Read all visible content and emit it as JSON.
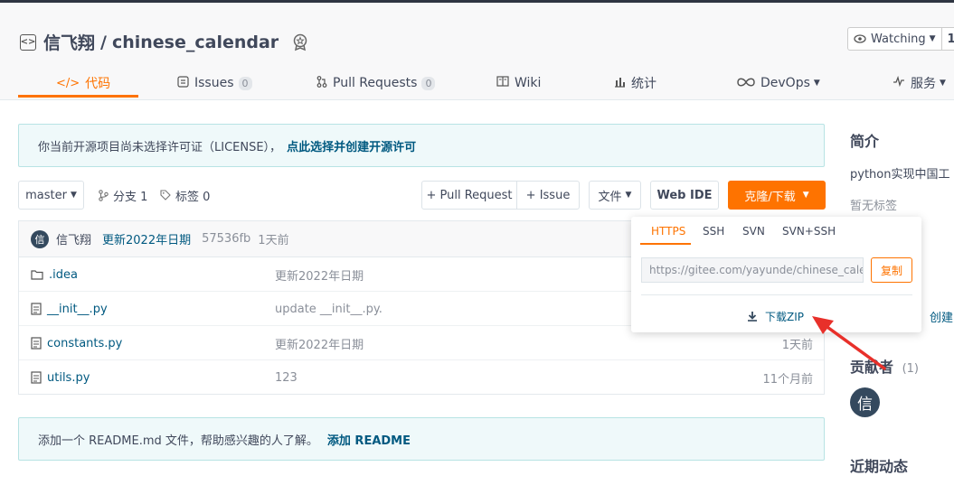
{
  "repo": {
    "owner": "信飞翔",
    "separator": "/",
    "name": "chinese_calendar"
  },
  "watch": {
    "label": "Watching",
    "count": "1"
  },
  "tabs": [
    {
      "label": "代码",
      "count": ""
    },
    {
      "label": "Issues",
      "count": "0"
    },
    {
      "label": "Pull Requests",
      "count": "0"
    },
    {
      "label": "Wiki",
      "count": ""
    },
    {
      "label": "统计",
      "count": ""
    },
    {
      "label": "DevOps",
      "count": ""
    },
    {
      "label": "服务",
      "count": ""
    }
  ],
  "license_notice": {
    "text": "你当前开源项目尚未选择许可证（LICENSE），",
    "link": "点此选择并创建开源许可"
  },
  "branchbar": {
    "branch": "master",
    "branches_label": "分支 1",
    "tags_label": "标签 0",
    "pull_request": "+ Pull Request",
    "issue": "+ Issue",
    "files": "文件",
    "web_ide": "Web IDE",
    "clone": "克隆/下载"
  },
  "commit": {
    "avatar": "信",
    "author": "信飞翔",
    "message": "更新2022年日期",
    "hash": "57536fb",
    "time": "1天前"
  },
  "files": [
    {
      "name": ".idea",
      "message": "更新2022年日期",
      "time": ""
    },
    {
      "name": "__init__.py",
      "message": "update __init__.py.",
      "time": ""
    },
    {
      "name": "constants.py",
      "message": "更新2022年日期",
      "time": "1天前"
    },
    {
      "name": "utils.py",
      "message": "123",
      "time": "11个月前"
    }
  ],
  "readme_notice": {
    "text": "添加一个 README.md 文件，帮助感兴趣的人了解。",
    "link": "添加 README"
  },
  "clone_dropdown": {
    "tabs": [
      "HTTPS",
      "SSH",
      "SVN",
      "SVN+SSH"
    ],
    "url": "https://gitee.com/yayunde/chinese_calendar.git",
    "copy": "复制",
    "download_zip": "下载ZIP"
  },
  "sidebar": {
    "intro_title": "简介",
    "intro_text": "python实现中国工",
    "no_tags": "暂无标签",
    "create_link": "创建",
    "contributors_title": "贡献者",
    "contributors_count": "(1)",
    "contributor_avatar": "信",
    "activity_title": "近期动态"
  },
  "colors": {
    "accent": "#fe7300",
    "link": "#005980",
    "annotation_arrow": "#e8302a"
  }
}
